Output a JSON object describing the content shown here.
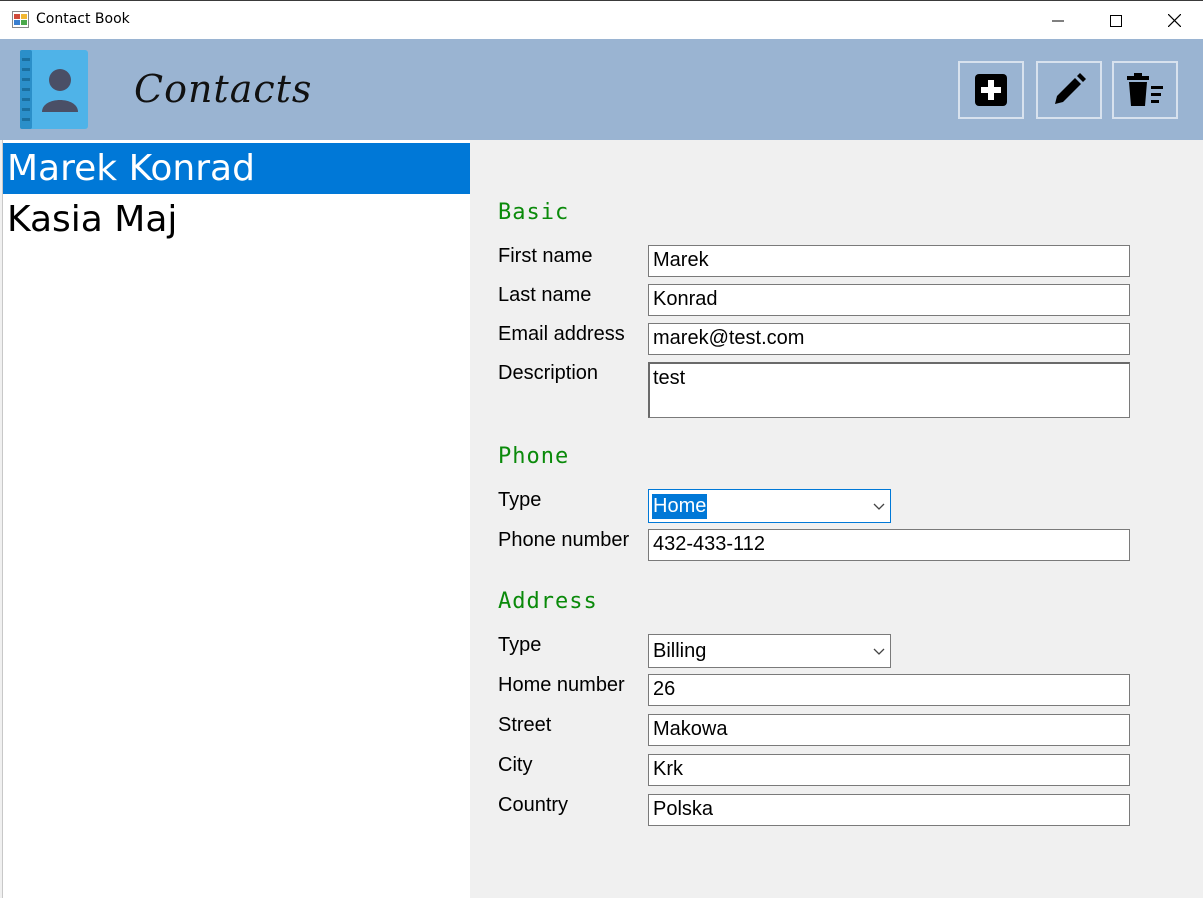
{
  "window": {
    "title": "Contact Book",
    "icon": "app-form-icon"
  },
  "header": {
    "title": "Contacts",
    "logo_icon": "address-book-icon",
    "toolbar": {
      "add_icon": "plus-box-icon",
      "edit_icon": "pencil-icon",
      "delete_icon": "delete-list-icon"
    }
  },
  "contacts": [
    {
      "name": "Marek Konrad",
      "selected": true
    },
    {
      "name": "Kasia Maj",
      "selected": false
    }
  ],
  "form": {
    "basic": {
      "title": "Basic",
      "first_name_label": "First name",
      "first_name": "Marek",
      "last_name_label": "Last name",
      "last_name": "Konrad",
      "email_label": "Email address",
      "email": "marek@test.com",
      "description_label": "Description",
      "description": "test"
    },
    "phone": {
      "title": "Phone",
      "type_label": "Type",
      "type": "Home",
      "number_label": "Phone number",
      "number": "432-433-112"
    },
    "address": {
      "title": "Address",
      "type_label": "Type",
      "type": "Billing",
      "home_number_label": "Home number",
      "home_number": "26",
      "street_label": "Street",
      "street": "Makowa",
      "city_label": "City",
      "city": "Krk",
      "country_label": "Country",
      "country": "Polska"
    }
  },
  "colors": {
    "header_bg": "#9ab4d2",
    "selection": "#0078d7",
    "section_title": "#0a8a0a"
  }
}
